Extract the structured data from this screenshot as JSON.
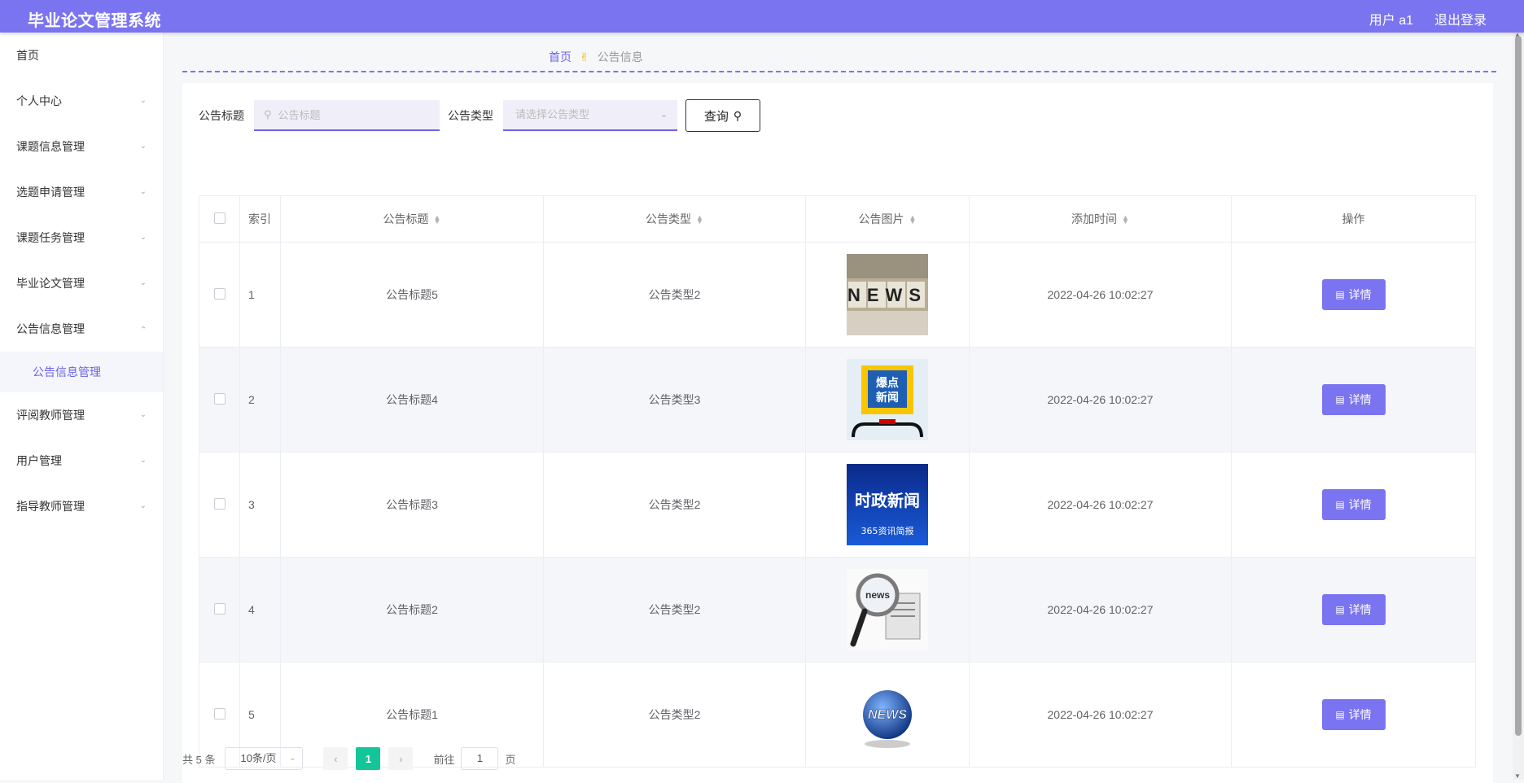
{
  "header": {
    "title": "毕业论文管理系统",
    "user": "用户 a1",
    "logout": "退出登录"
  },
  "sidebar": {
    "items": [
      {
        "label": "首页"
      },
      {
        "label": "个人中心"
      },
      {
        "label": "课题信息管理"
      },
      {
        "label": "选题申请管理"
      },
      {
        "label": "课题任务管理"
      },
      {
        "label": "毕业论文管理"
      },
      {
        "label": "公告信息管理"
      },
      {
        "label": "评阅教师管理"
      },
      {
        "label": "用户管理"
      },
      {
        "label": "指导教师管理"
      }
    ],
    "submenu": "公告信息管理"
  },
  "breadcrumb": {
    "home": "首页",
    "current": "公告信息"
  },
  "search": {
    "title_label": "公告标题",
    "title_placeholder": "公告标题",
    "type_label": "公告类型",
    "type_placeholder": "请选择公告类型",
    "query_label": "查询"
  },
  "table": {
    "headers": {
      "index": "索引",
      "title": "公告标题",
      "type": "公告类型",
      "image": "公告图片",
      "time": "添加时间",
      "action": "操作"
    },
    "rows": [
      {
        "index": "1",
        "title": "公告标题5",
        "type": "公告类型2",
        "image": "news-dice-image",
        "time": "2022-04-26 10:02:27",
        "action": "详情"
      },
      {
        "index": "2",
        "title": "公告标题4",
        "type": "公告类型3",
        "image": "baodian-xinwen-image",
        "time": "2022-04-26 10:02:27",
        "action": "详情"
      },
      {
        "index": "3",
        "title": "公告标题3",
        "type": "公告类型2",
        "image": "shizheng-xinwen-image",
        "time": "2022-04-26 10:02:27",
        "action": "详情"
      },
      {
        "index": "4",
        "title": "公告标题2",
        "type": "公告类型2",
        "image": "news-magnifier-image",
        "time": "2022-04-26 10:02:27",
        "action": "详情"
      },
      {
        "index": "5",
        "title": "公告标题1",
        "type": "公告类型2",
        "image": "news-globe-image",
        "time": "2022-04-26 10:02:27",
        "action": "详情"
      }
    ],
    "image_texts": {
      "r1": "NEWS",
      "r2a": "爆点",
      "r2b": "新闻",
      "r3a": "时政新闻",
      "r3b": "365资讯简报",
      "r4": "news",
      "r5": "NEWS"
    }
  },
  "pagination": {
    "total": "共 5 条",
    "page_size": "10条/页",
    "current_page": "1",
    "goto_label": "前往",
    "goto_value": "1",
    "page_suffix": "页"
  },
  "colors": {
    "primary": "#7b74f0",
    "active_page": "#13c69a"
  }
}
